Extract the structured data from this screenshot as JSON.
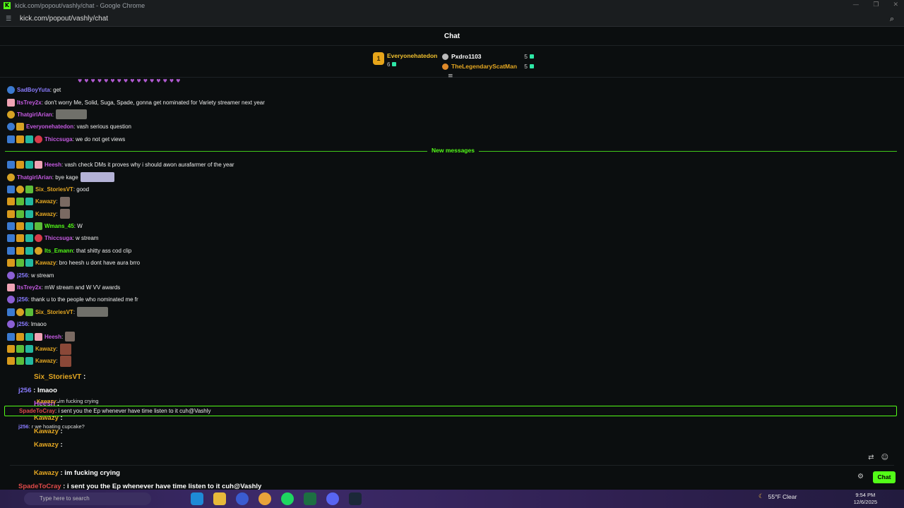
{
  "browser": {
    "window_title": "kick.com/popout/vashly/chat - Google Chrome",
    "url": "kick.com/popout/vashly/chat"
  },
  "header": {
    "title": "Chat"
  },
  "leaderboard": {
    "first": {
      "rank": "1",
      "name": "Everyonehatedon",
      "count": "6"
    },
    "others": [
      {
        "name": "Pxdro1103",
        "count": "5"
      },
      {
        "name": "TheLegendaryScatMan",
        "count": "5"
      }
    ]
  },
  "new_messages_label": "New messages",
  "messages_before": [
    {
      "user": "SadBoyYuta",
      "color": "#8a7cff",
      "text": ": get",
      "badges": [
        "blue round"
      ]
    },
    {
      "user": "ItsTrey2x",
      "color": "#c45ae0",
      "text": ": don't worry Me, Solid, Suga, Spade, gonna get nominated for Variety streamer next year",
      "badges": [
        "pink"
      ]
    },
    {
      "user": "ThatgirlArian",
      "color": "#c45ae0",
      "text": ":",
      "badges": [
        "gold round"
      ],
      "emote": "wide"
    },
    {
      "user": "Everyonehatedon",
      "color": "#c45ae0",
      "text": ": vash serious question",
      "badges": [
        "blue round",
        "gold"
      ]
    },
    {
      "user": "Thiccsuga",
      "color": "#c45ae0",
      "text": ": we do not get views",
      "badges": [
        "blue",
        "crown",
        "teal",
        "red"
      ]
    }
  ],
  "messages_after": [
    {
      "user": "Heesh",
      "color": "#c45ae0",
      "text": ": vash check DMs it proves why i should awon aurafarmer of the year",
      "badges": [
        "blue",
        "crown",
        "teal",
        "pink"
      ]
    },
    {
      "user": "ThatgirlArian",
      "color": "#c45ae0",
      "text": ": bye kage",
      "badges": [
        "gold round"
      ],
      "emote": "lavender"
    },
    {
      "user": "Six_StoriesVT",
      "color": "#e6a822",
      "text": ": good",
      "badges": [
        "blue",
        "gold round",
        "green"
      ]
    },
    {
      "user": "Kawazy",
      "color": "#e6a822",
      "text": ":",
      "badges": [
        "crown",
        "green",
        "teal"
      ],
      "emote": "small"
    },
    {
      "user": "Kawazy",
      "color": "#e6a822",
      "text": ":",
      "badges": [
        "crown",
        "green",
        "teal"
      ],
      "emote": "small"
    },
    {
      "user": "Wmans_45",
      "color": "#53fc18",
      "text": ": W",
      "badges": [
        "blue",
        "crown",
        "teal",
        "green"
      ]
    },
    {
      "user": "Thiccsuga",
      "color": "#c45ae0",
      "text": ": w stream",
      "badges": [
        "blue",
        "crown",
        "teal",
        "red"
      ]
    },
    {
      "user": "Its_Emann",
      "color": "#53fc18",
      "text": ": that shitty ass cod clip",
      "badges": [
        "blue",
        "crown",
        "teal",
        "gold round"
      ]
    },
    {
      "user": "Kawazy",
      "color": "#e6a822",
      "text": ": bro heesh u dont have aura brro",
      "badges": [
        "crown",
        "green",
        "teal"
      ]
    },
    {
      "user": "j256",
      "color": "#8a7cff",
      "text": ": w stream",
      "badges": [
        "purple round"
      ]
    },
    {
      "user": "ItsTrey2x",
      "color": "#c45ae0",
      "text": ": mW stream and W VV awards",
      "badges": [
        "pink"
      ]
    },
    {
      "user": "j256",
      "color": "#8a7cff",
      "text": ": thank u to the people who nominated me fr",
      "badges": [
        "purple round"
      ]
    },
    {
      "user": "Six_StoriesVT",
      "color": "#e6a822",
      "text": ":",
      "badges": [
        "blue",
        "gold round",
        "green"
      ],
      "emote": "wide"
    },
    {
      "user": "j256",
      "color": "#8a7cff",
      "text": ": lmaoo",
      "badges": [
        "purple round"
      ]
    },
    {
      "user": "Heesh",
      "color": "#c45ae0",
      "text": ":",
      "badges": [
        "blue",
        "crown",
        "teal",
        "pink"
      ],
      "emote": "small"
    },
    {
      "user": "Kawazy",
      "color": "#e6a822",
      "text": ":",
      "badges": [
        "crown",
        "green",
        "teal"
      ],
      "emote": "tall"
    },
    {
      "user": "Kawazy",
      "color": "#e6a822",
      "text": ":",
      "badges": [
        "crown",
        "green",
        "teal"
      ],
      "emote": "tall"
    }
  ],
  "highlighted_message": {
    "user": "SpadeToCray",
    "text": ": i sent you the Ep whenever have time listen to it cuh@Vashly"
  },
  "overlay_lines": [
    {
      "user": "Six_StoriesVT",
      "text": " :",
      "color": "#e6a822"
    },
    {
      "user": "j256",
      "text": " : lmaoo",
      "color": "#8a7cff"
    },
    {
      "user": "Heesh",
      "text": " :",
      "color": "#c45ae0"
    },
    {
      "user": "Kawazy",
      "text": " :",
      "color": "#e6a822"
    },
    {
      "user": "Kawazy",
      "text": " :",
      "color": "#e6a822"
    },
    {
      "user": "Kawazy",
      "text": " :",
      "color": "#e6a822"
    },
    {
      "user": "Kawazy",
      "text": " : im fucking crying",
      "color": "#e6a822"
    },
    {
      "user": "SpadeToCray",
      "text": " : i sent you the Ep whenever have time listen to it cuh@Vashly",
      "color": "#e04a4a"
    },
    {
      "user": "j256",
      "text": " : r we hoating cupcake?",
      "color": "#8a7cff"
    }
  ],
  "small_overlay_lines": [
    {
      "user": "Kawazy",
      "text": ": im fucking crying",
      "color": "#e6a822"
    },
    {
      "user": "j256",
      "text": ": r we hoating cupcake?",
      "color": "#8a7cff"
    }
  ],
  "chat_button_label": "Chat",
  "taskbar": {
    "search_placeholder": "Type here to search",
    "weather": "55°F  Clear",
    "time": "9:54 PM",
    "date": "12/6/2025"
  },
  "colors": {
    "accent": "#53fc18",
    "background": "#0b0e0f"
  }
}
